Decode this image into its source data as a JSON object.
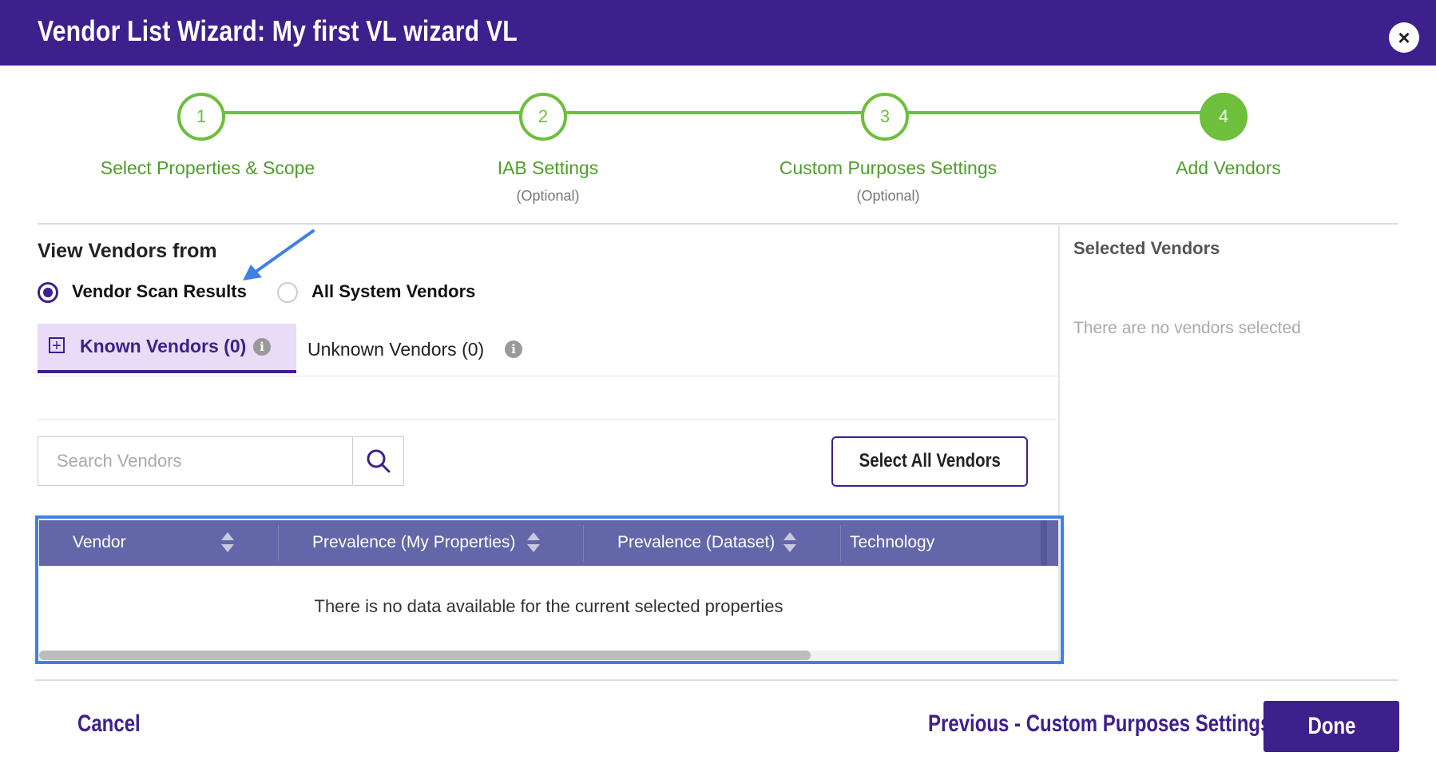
{
  "window": {
    "title": "Vendor List Wizard: My first VL wizard VL",
    "close_icon": "×"
  },
  "stepper": {
    "steps": [
      {
        "number": "1",
        "label": "Select Properties & Scope",
        "sub": ""
      },
      {
        "number": "2",
        "label": "IAB Settings",
        "sub": "(Optional)"
      },
      {
        "number": "3",
        "label": "Custom Purposes Settings",
        "sub": "(Optional)"
      },
      {
        "number": "4",
        "label": "Add Vendors",
        "sub": ""
      }
    ],
    "active_step": 4
  },
  "view_vendors": {
    "title": "View Vendors from",
    "options": [
      "Vendor Scan Results",
      "All System Vendors"
    ],
    "selected": "Vendor Scan Results"
  },
  "tabs": {
    "known": "Known Vendors (0)",
    "unknown": "Unknown Vendors (0)",
    "info": "i"
  },
  "search": {
    "placeholder": "Search Vendors"
  },
  "select_all_label": "Select All Vendors",
  "table": {
    "columns": [
      "Vendor",
      "Prevalence (My Properties)",
      "Prevalence (Dataset)",
      "Technology"
    ],
    "empty_message": "There is no data available for the current selected properties"
  },
  "selected_panel": {
    "title": "Selected Vendors",
    "empty": "There are no vendors selected"
  },
  "footer": {
    "cancel": "Cancel",
    "previous": "Previous - Custom Purposes Settings",
    "done": "Done"
  },
  "colors": {
    "brand": "#3e208c",
    "step": "#6dbf3c",
    "table_head": "#6366a8",
    "highlight": "#3f7fe8"
  }
}
